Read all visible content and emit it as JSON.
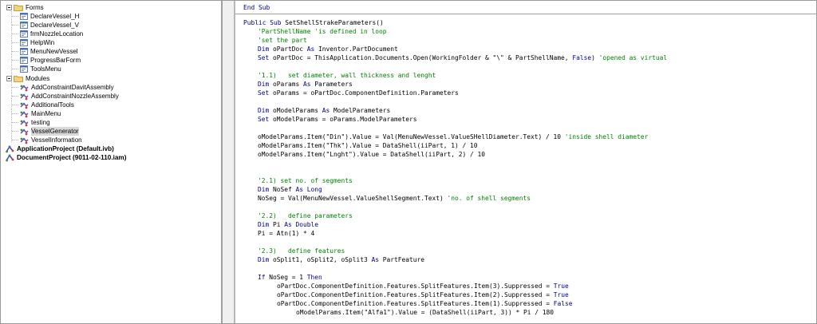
{
  "explorer": {
    "groups": {
      "forms_label": "Forms",
      "modules_label": "Modules"
    },
    "forms": [
      "DeclareVessel_H",
      "DeclareVessel_V",
      "frmNozzleLocation",
      "HelpWin",
      "MenuNewVessel",
      "ProgressBarForm",
      "ToolsMenu"
    ],
    "modules": [
      "AddConstraintDavitAssembly",
      "AddConstraintNozzleAssembly",
      "AdditionalTools",
      "MainMenu",
      "testing",
      "VesselGenerator",
      "VesselInformation"
    ],
    "projects": [
      "ApplicationProject (Default.ivb)",
      "DocumentProject (9011-02-110.iam)"
    ],
    "selected_module": "VesselGenerator"
  },
  "code": {
    "end_sub": "End Sub",
    "lines": [
      {
        "indent": 0,
        "text": "",
        "keyword": "Public Sub",
        "rest": " SetShellStrakeParameters()",
        "comment": ""
      },
      {
        "indent": 1,
        "text": "",
        "keyword": "",
        "rest": "",
        "comment": "'PartShellName 'is defined in loop"
      },
      {
        "indent": 1,
        "text": "",
        "keyword": "",
        "rest": "",
        "comment": "'set the part"
      },
      {
        "indent": 1,
        "text": "",
        "keyword": "Dim",
        "rest": " oPartDoc ",
        "keyword2": "As",
        "rest2": " Inventor.PartDocument",
        "comment": ""
      },
      {
        "indent": 1,
        "text": "",
        "keyword": "Set",
        "rest": " oPartDoc = ThisApplication.Documents.Open(WorkingFolder & \"\\\" & PartShellName, ",
        "keyword2": "False",
        "rest2": ") ",
        "comment": "'opened as virtual"
      },
      {
        "indent": 0,
        "text": "",
        "keyword": "",
        "rest": "",
        "comment": ""
      },
      {
        "indent": 1,
        "text": "",
        "keyword": "",
        "rest": "",
        "comment": "'1.1)   set diameter, wall thickness and lenght"
      },
      {
        "indent": 1,
        "text": "",
        "keyword": "Dim",
        "rest": " oParams ",
        "keyword2": "As",
        "rest2": " Parameters",
        "comment": ""
      },
      {
        "indent": 1,
        "text": "",
        "keyword": "Set",
        "rest": " oParams = oPartDoc.ComponentDefinition.Parameters",
        "comment": ""
      },
      {
        "indent": 0,
        "text": "",
        "keyword": "",
        "rest": "",
        "comment": ""
      },
      {
        "indent": 1,
        "text": "",
        "keyword": "Dim",
        "rest": " oModelParams ",
        "keyword2": "As",
        "rest2": " ModelParameters",
        "comment": ""
      },
      {
        "indent": 1,
        "text": "",
        "keyword": "Set",
        "rest": " oModelParams = oParams.ModelParameters",
        "comment": ""
      },
      {
        "indent": 0,
        "text": "",
        "keyword": "",
        "rest": "",
        "comment": ""
      },
      {
        "indent": 1,
        "text": "",
        "keyword": "",
        "rest": "oModelParams.Item(\"Din\").Value = Val(MenuNewVessel.ValueSHellDiameter.Text) / 10 ",
        "comment": "'inside shell diameter"
      },
      {
        "indent": 1,
        "text": "",
        "keyword": "",
        "rest": "oModelParams.Item(\"Thk\").Value = DataShell(iiPart, 1) / 10",
        "comment": ""
      },
      {
        "indent": 1,
        "text": "",
        "keyword": "",
        "rest": "oModelParams.Item(\"Lnght\").Value = DataShell(iiPart, 2) / 10",
        "comment": ""
      },
      {
        "indent": 0,
        "text": "",
        "keyword": "",
        "rest": "",
        "comment": ""
      },
      {
        "indent": 0,
        "text": "",
        "keyword": "",
        "rest": "",
        "comment": ""
      },
      {
        "indent": 1,
        "text": "",
        "keyword": "",
        "rest": "",
        "comment": "'2.1) set no. of segments"
      },
      {
        "indent": 1,
        "text": "",
        "keyword": "Dim",
        "rest": " NoSef ",
        "keyword2": "As Long",
        "rest2": "",
        "comment": ""
      },
      {
        "indent": 1,
        "text": "",
        "keyword": "",
        "rest": "NoSeg = Val(MenuNewVessel.ValueShellSegment.Text) ",
        "comment": "'no. of shell segments"
      },
      {
        "indent": 0,
        "text": "",
        "keyword": "",
        "rest": "",
        "comment": ""
      },
      {
        "indent": 1,
        "text": "",
        "keyword": "",
        "rest": "",
        "comment": "'2.2)   define parameters"
      },
      {
        "indent": 1,
        "text": "",
        "keyword": "Dim",
        "rest": " Pi ",
        "keyword2": "As Double",
        "rest2": "",
        "comment": ""
      },
      {
        "indent": 1,
        "text": "",
        "keyword": "",
        "rest": "Pi = Atn(1) * 4",
        "comment": ""
      },
      {
        "indent": 0,
        "text": "",
        "keyword": "",
        "rest": "",
        "comment": ""
      },
      {
        "indent": 1,
        "text": "",
        "keyword": "",
        "rest": "",
        "comment": "'2.3)   define features"
      },
      {
        "indent": 1,
        "text": "",
        "keyword": "Dim",
        "rest": " oSplit1, oSplit2, oSplit3 ",
        "keyword2": "As",
        "rest2": " PartFeature",
        "comment": ""
      },
      {
        "indent": 0,
        "text": "",
        "keyword": "",
        "rest": "",
        "comment": ""
      },
      {
        "indent": 1,
        "text": "",
        "keyword": "If",
        "rest": " NoSeg = 1 ",
        "keyword2": "Then",
        "rest2": "",
        "comment": ""
      },
      {
        "indent": 2,
        "text": "",
        "keyword": "",
        "rest": "oPartDoc.ComponentDefinition.Features.SplitFeatures.Item(3).Suppressed = ",
        "keyword2": "True",
        "rest2": "",
        "comment": ""
      },
      {
        "indent": 2,
        "text": "",
        "keyword": "",
        "rest": "oPartDoc.ComponentDefinition.Features.SplitFeatures.Item(2).Suppressed = ",
        "keyword2": "True",
        "rest2": "",
        "comment": ""
      },
      {
        "indent": 2,
        "text": "",
        "keyword": "",
        "rest": "oPartDoc.ComponentDefinition.Features.SplitFeatures.Item(1).Suppressed = ",
        "keyword2": "False",
        "rest2": "",
        "comment": ""
      },
      {
        "indent": 3,
        "text": "",
        "keyword": "",
        "rest": "oModelParams.Item(\"Alfa1\").Value = (DataShell(iiPart, 3)) * Pi / 180",
        "comment": ""
      }
    ]
  },
  "colors": {
    "keyword": "#00008b",
    "comment": "#008000",
    "text": "#000000",
    "selection": "#d9d9d9"
  },
  "icons": {
    "folder": "folder-icon",
    "form": "form-icon",
    "module": "module-icon",
    "project": "project-icon"
  }
}
